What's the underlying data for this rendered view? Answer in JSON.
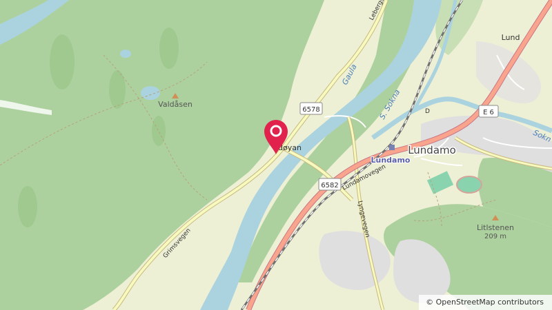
{
  "attribution": "© OpenStreetMap contributors",
  "places": {
    "valdasen": "Valdåsen",
    "lund": "Lund",
    "lundamo_town": "Lundamo",
    "lundamo_station": "Lundamo",
    "oyan": "døyan",
    "litlstenen": "Litlstenen",
    "litlstenen_elev": "209 m"
  },
  "rivers": {
    "gaula": "Gaula",
    "sokna": "Sokna",
    "sokna_short": "S. Sokna",
    "sokna_east": "Sokn"
  },
  "roads": {
    "lebergs": "Lebergsv",
    "grimsvegen": "Grimsvegen",
    "lundamovegen": "Lundamovegen",
    "lyngevegen": "Lyngevegen",
    "r6578": "6578",
    "r6582": "6582",
    "e6": "E 6",
    "d_label": "D"
  },
  "colors": {
    "forest": "#add19e",
    "river": "#aad3df",
    "trunk": "#e892a2",
    "secondary": "#f7fabf",
    "rail": "#707070",
    "marker": "#e0224c"
  }
}
